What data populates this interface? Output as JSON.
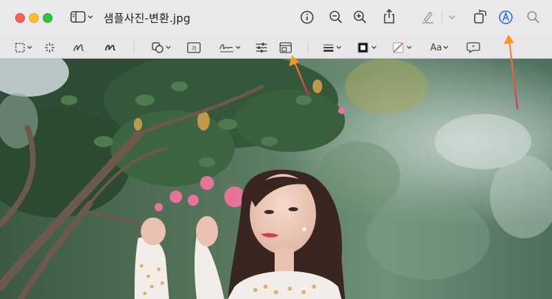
{
  "window": {
    "title": "샘플사진-변환.jpg"
  },
  "toolbar_top": {
    "sidebar_icon": "sidebar-icon",
    "info_icon": "info-icon",
    "zoom_out_icon": "zoom-out-icon",
    "zoom_in_icon": "zoom-in-icon",
    "share_icon": "share-icon",
    "highlight_icon": "highlight-pen-icon",
    "rotate_icon": "rotate-icon",
    "markup_icon": "markup-icon",
    "search_icon": "search-icon"
  },
  "markup_toolbar": {
    "tools": [
      "selection",
      "instant-alpha",
      "sketch",
      "draw",
      "shapes",
      "text",
      "sign",
      "adjust-color",
      "adjust-size",
      "shape-style",
      "border-color",
      "fill-color",
      "text-style",
      "annotate"
    ],
    "text_style_label": "Aa",
    "text_box_label": "가"
  },
  "colors": {
    "accent": "#1a6fe8",
    "arrow_orange": "#f59a1e",
    "arrow_pink": "#e0245e"
  }
}
